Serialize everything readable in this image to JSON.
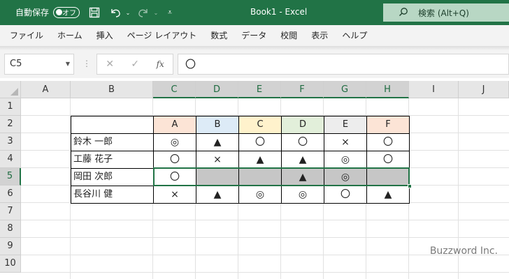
{
  "titlebar": {
    "autosave_label": "自動保存",
    "autosave_state": "オフ",
    "doc_title": "Book1  -  Excel",
    "search_placeholder": "検索 (Alt+Q)"
  },
  "menu": [
    "ファイル",
    "ホーム",
    "挿入",
    "ページ レイアウト",
    "数式",
    "データ",
    "校閲",
    "表示",
    "ヘルプ"
  ],
  "formula_bar": {
    "name_box": "C5",
    "fx": "fx",
    "value": "〇"
  },
  "columns": [
    "A",
    "B",
    "C",
    "D",
    "E",
    "F",
    "G",
    "H",
    "I",
    "J"
  ],
  "selected_columns": [
    "C",
    "D",
    "E",
    "F",
    "G",
    "H"
  ],
  "rows": [
    "1",
    "2",
    "3",
    "4",
    "5",
    "6",
    "7",
    "8",
    "9",
    "10"
  ],
  "selected_row": "5",
  "table": {
    "headers": [
      "A",
      "B",
      "C",
      "D",
      "E",
      "F"
    ],
    "header_colors": [
      "#fce4d6",
      "#ddebf7",
      "#fff2cc",
      "#e2efda",
      "#ededed",
      "#fce4d6"
    ],
    "rows": [
      {
        "name": "鈴木 一郎",
        "marks": [
          "◎",
          "▲",
          "〇",
          "〇",
          "×",
          "〇"
        ]
      },
      {
        "name": "工藤 花子",
        "marks": [
          "〇",
          "×",
          "▲",
          "▲",
          "◎",
          "〇"
        ]
      },
      {
        "name": "岡田 次郎",
        "marks": [
          "〇",
          "",
          "",
          "▲",
          "◎",
          ""
        ]
      },
      {
        "name": "長谷川 健",
        "marks": [
          "×",
          "▲",
          "◎",
          "◎",
          "〇",
          "▲"
        ]
      }
    ],
    "gray_cells": [
      [
        2,
        1
      ],
      [
        2,
        2
      ],
      [
        2,
        3
      ],
      [
        2,
        4
      ],
      [
        2,
        5
      ]
    ]
  },
  "watermark": "Buzzword Inc."
}
